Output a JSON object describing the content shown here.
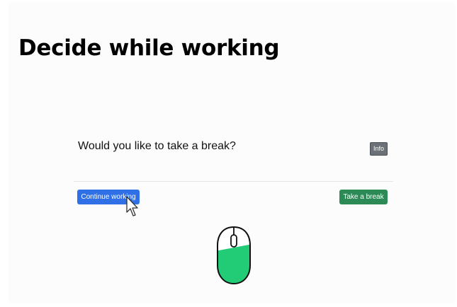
{
  "slide": {
    "title": "Decide while working"
  },
  "dialog": {
    "question": "Would you like to take a break?",
    "info_label": "Info",
    "continue_label": "Continue working",
    "break_label": "Take a break"
  },
  "colors": {
    "primary": "#2f70e6",
    "success": "#2b8a55",
    "secondary": "#6b7176",
    "mouse_fill": "#22cc77"
  },
  "icons": {
    "cursor": "mouse-pointer-arrow",
    "mouse": "computer-mouse-left-click"
  }
}
